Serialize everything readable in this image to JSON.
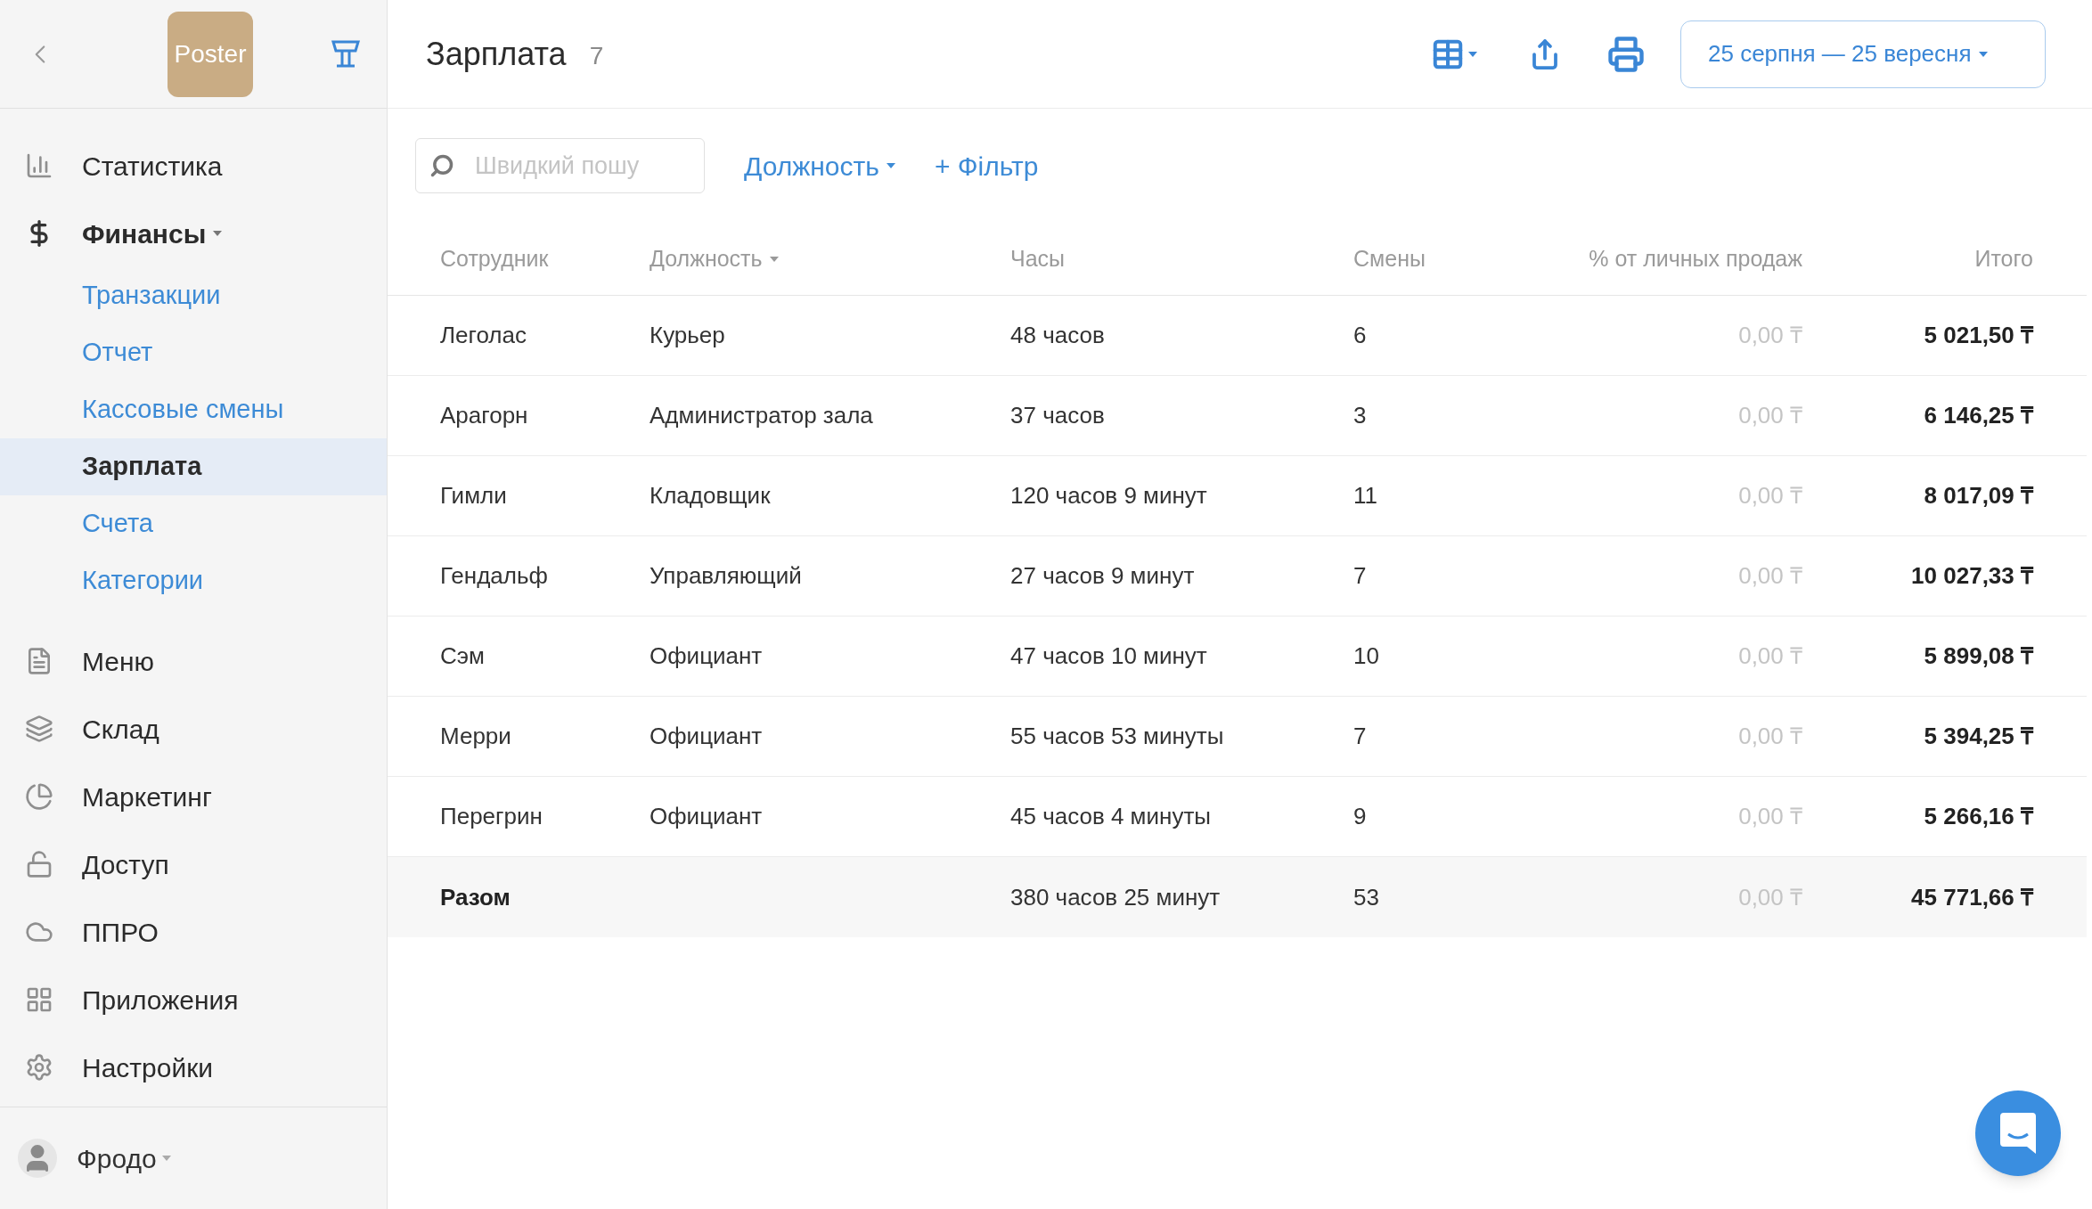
{
  "sidebar": {
    "logo": "Poster",
    "items": [
      {
        "label": "Статистика"
      },
      {
        "label": "Финансы",
        "expanded": true,
        "children": [
          {
            "label": "Транзакции",
            "selected": false
          },
          {
            "label": "Отчет",
            "selected": false
          },
          {
            "label": "Кассовые смены",
            "selected": false
          },
          {
            "label": "Зарплата",
            "selected": true
          },
          {
            "label": "Счета",
            "selected": false
          },
          {
            "label": "Категории",
            "selected": false
          }
        ]
      },
      {
        "label": "Меню"
      },
      {
        "label": "Склад"
      },
      {
        "label": "Маркетинг"
      },
      {
        "label": "Доступ"
      },
      {
        "label": "ППРО"
      },
      {
        "label": "Приложения"
      },
      {
        "label": "Настройки"
      }
    ],
    "user": {
      "name": "Фродо"
    }
  },
  "header": {
    "title": "Зарплата",
    "count": "7",
    "date_range": "25 серпня — 25 вересня"
  },
  "filters": {
    "search": {
      "placeholder": "Швидкий пошу"
    },
    "position_filter": "Должность",
    "add_filter": "+ Фільтр"
  },
  "table": {
    "columns": [
      {
        "label": "Сотрудник",
        "sorted": false
      },
      {
        "label": "Должность",
        "sorted": true
      },
      {
        "label": "Часы",
        "sorted": false
      },
      {
        "label": "Смены",
        "sorted": false
      },
      {
        "label": "% от личных продаж",
        "sorted": false
      },
      {
        "label": "Итого",
        "sorted": false
      }
    ],
    "rows": [
      [
        "Леголас",
        "Курьер",
        "48 часов",
        "6",
        "0,00 ₸",
        "5 021,50 ₸"
      ],
      [
        "Арагорн",
        "Администратор зала",
        "37 часов",
        "3",
        "0,00 ₸",
        "6 146,25 ₸"
      ],
      [
        "Гимли",
        "Кладовщик",
        "120 часов 9 минут",
        "11",
        "0,00 ₸",
        "8 017,09 ₸"
      ],
      [
        "Гендальф",
        "Управляющий",
        "27 часов 9 минут",
        "7",
        "0,00 ₸",
        "10 027,33 ₸"
      ],
      [
        "Сэм",
        "Официант",
        "47 часов 10 минут",
        "10",
        "0,00 ₸",
        "5 899,08 ₸"
      ],
      [
        "Мерри",
        "Официант",
        "55 часов 53 минуты",
        "7",
        "0,00 ₸",
        "5 394,25 ₸"
      ],
      [
        "Перегрин",
        "Официант",
        "45 часов 4 минуты",
        "9",
        "0,00 ₸",
        "5 266,16 ₸"
      ]
    ],
    "total": {
      "label": "Разом",
      "hours": "380 часов 25 минут",
      "shifts": "53",
      "percent": "0,00 ₸",
      "sum": "45 771,66 ₸"
    }
  }
}
